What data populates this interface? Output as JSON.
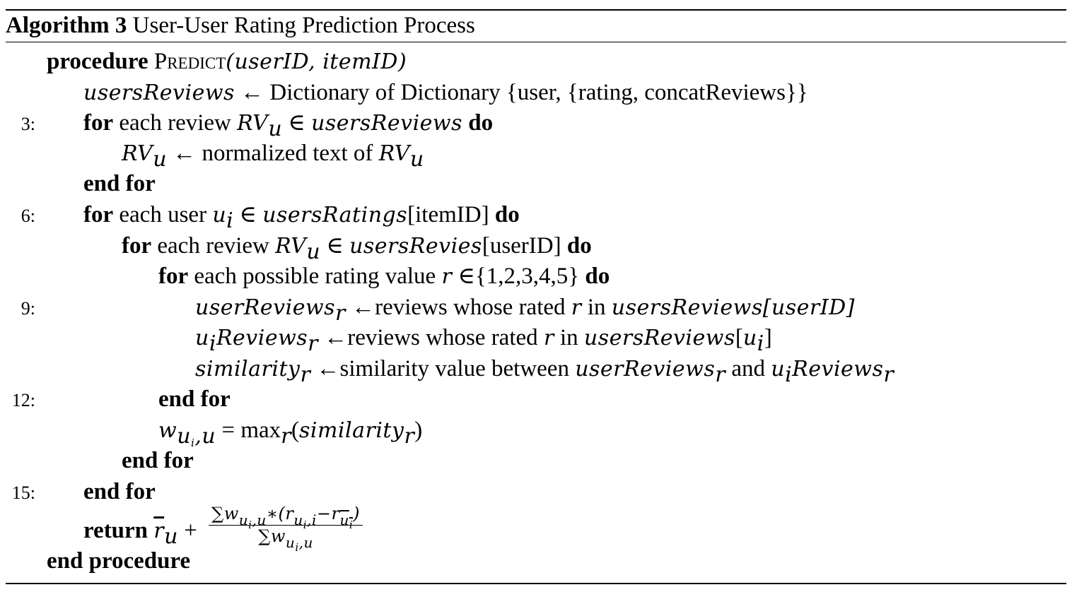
{
  "algorithm": {
    "label": "Algorithm 3",
    "title": "User-User Rating Prediction Process"
  },
  "lines": {
    "l1": {
      "kw": "procedure",
      "name": "Predict",
      "args": "(userID, itemID)"
    },
    "l2": {
      "var": "usersReviews",
      "arrow": "←",
      "text": "Dictionary of Dictionary {user, {rating, concatReviews}}"
    },
    "l3": {
      "num": "3:",
      "kw": "for",
      "text1": "each review",
      "var": "RV",
      "sub": "u",
      "in": "∈",
      "set": "usersReviews",
      "kw2": "do"
    },
    "l4": {
      "var": "RV",
      "sub": "u",
      "arrow": "←",
      "text": "normalized text of",
      "var2": "RV",
      "sub2": "u"
    },
    "l5": {
      "kw": "end for"
    },
    "l6": {
      "num": "6:",
      "kw": "for",
      "text1": "each user",
      "var": "u",
      "sub": "i",
      "in": "∈",
      "set": "usersRatings",
      "index": "[itemID]",
      "kw2": "do"
    },
    "l7": {
      "kw": "for",
      "text1": "each review",
      "var": "RV",
      "sub": "u",
      "in": "∈",
      "set": "usersRevies",
      "index": "[userID]",
      "kw2": "do"
    },
    "l8": {
      "kw": "for",
      "text1": "each possible rating value",
      "var": "r",
      "in": "∈{1,2,3,4,5}",
      "kw2": "do"
    },
    "l9": {
      "num": "9:",
      "var": "userReviews",
      "sub": "r",
      "arrow": "←",
      "text": "reviews whose rated",
      "r": "r",
      "in": "in",
      "set": "usersReviews",
      "index": "[userID]"
    },
    "l10": {
      "var": "u",
      "sub": "i",
      "var_b": "Reviews",
      "sub_b": "r",
      "arrow": "←",
      "text": "reviews whose rated",
      "r": "r",
      "in": "in",
      "set": "usersReviews",
      "index_open": "[",
      "index_var": "u",
      "index_sub": "i",
      "index_close": "]"
    },
    "l11": {
      "var": "similarity",
      "sub": "r",
      "arrow": "←",
      "text": "similarity value between",
      "v1": "userReviews",
      "s1": "r",
      "and": "and",
      "v2a": "u",
      "s2a": "i",
      "v2b": "Reviews",
      "s2b": "r"
    },
    "l12": {
      "num": "12:",
      "kw": "end for"
    },
    "l13": {
      "w": "w",
      "wsub1": "u",
      "wsub2": "i",
      "wsub3": ",u",
      "eq": "=",
      "max": "max",
      "maxsub": "r",
      "arg_open": "(",
      "arg": "similarity",
      "argsub": "r",
      "arg_close": ")"
    },
    "l14": {
      "kw": "end for"
    },
    "l15": {
      "num": "15:",
      "kw": "end for"
    },
    "l16": {
      "kw": "return",
      "rbar": "r",
      "rsub": "u",
      "plus": "+",
      "num_text": "∑w",
      "num_sub1": "u",
      "num_sub2": "i",
      "num_sub3": ",u",
      "num_rest": "∗(r",
      "num_rsub1": "u",
      "num_rsub2": "i",
      "num_rsub3": ",i",
      "num_minus": "−r",
      "num_bsub1": "u",
      "num_bsub2": "i",
      "num_close": ")",
      "den_text": "∑w",
      "den_sub1": "u",
      "den_sub2": "i",
      "den_sub3": ",u"
    },
    "l17": {
      "kw": "end procedure"
    }
  }
}
